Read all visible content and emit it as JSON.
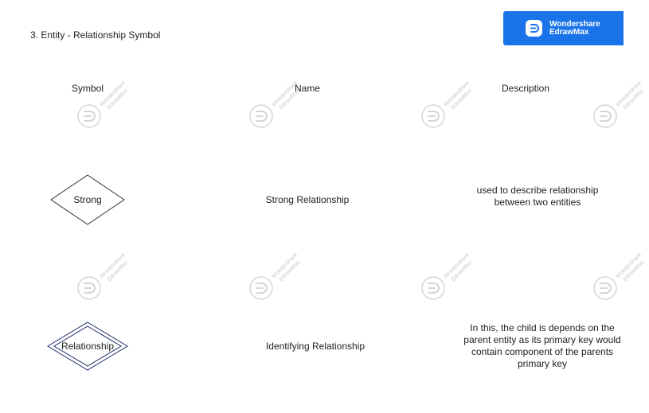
{
  "page": {
    "title": "3. Entity - Relationship Symbol"
  },
  "brand": {
    "line1": "Wondershare",
    "line2": "EdrawMax",
    "color": "#1a73e8"
  },
  "table": {
    "headers": {
      "symbol": "Symbol",
      "name": "Name",
      "description": "Description"
    },
    "rows": [
      {
        "symbol_label": "Strong",
        "symbol_shape": "diamond",
        "name": "Strong Relationship",
        "description": "used to describe relationship between two entities"
      },
      {
        "symbol_label": "Relationship",
        "symbol_shape": "double-diamond",
        "name": "Identifying Relationship",
        "description": "In this, the child is depends on the parent entity as its primary key would contain component of the parents primary key"
      }
    ]
  },
  "watermark": {
    "line1": "Wondershare",
    "line2": "EdrawMax",
    "icon": "edrawmax-logo-icon"
  }
}
